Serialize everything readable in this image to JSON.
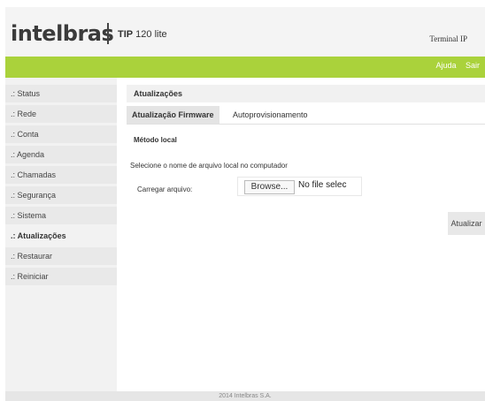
{
  "header": {
    "logo": "intelbras",
    "product_bold": "TIP",
    "product_rest": " 120 lite",
    "terminal": "Terminal IP"
  },
  "topbar": {
    "help": "Ajuda",
    "logout": "Sair"
  },
  "sidebar": {
    "items": [
      {
        "label": ".: Status"
      },
      {
        "label": ".: Rede"
      },
      {
        "label": ".: Conta"
      },
      {
        "label": ".: Agenda"
      },
      {
        "label": ".: Chamadas"
      },
      {
        "label": ".: Segurança"
      },
      {
        "label": ".: Sistema"
      },
      {
        "label": ".: Atualizações",
        "active": true
      },
      {
        "label": ".: Restaurar"
      },
      {
        "label": ".: Reiniciar"
      }
    ]
  },
  "main": {
    "title": "Atualizações",
    "tabs": [
      {
        "label": "Atualização Firmware",
        "active": true
      },
      {
        "label": "Autoprovisionamento"
      }
    ],
    "section": "Método local",
    "description": "Selecione o nome de arquivo local no computador",
    "upload_label": "Carregar arquivo:",
    "browse": "Browse...",
    "file_status": "No file selec",
    "update_button": "Atualizar"
  },
  "footer": "2014 Intelbras S.A."
}
